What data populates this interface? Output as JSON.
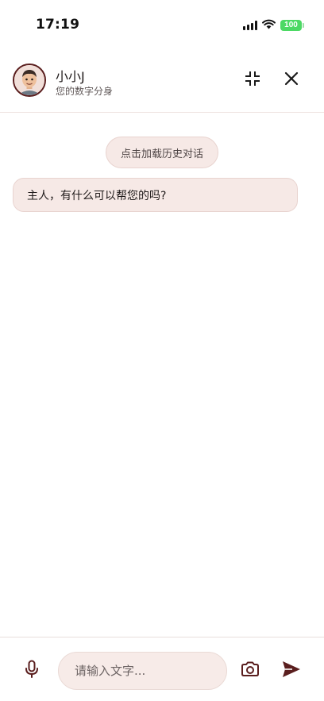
{
  "status_bar": {
    "time": "17:19",
    "battery_level": "100",
    "icons": [
      "signal-icon",
      "wifi-icon",
      "battery-icon"
    ],
    "battery_color": "#4cd964"
  },
  "header": {
    "bot_name": "小小J",
    "bot_subtitle": "您的数字分身",
    "icons": [
      "avatar",
      "collapse-icon",
      "close-icon"
    ]
  },
  "chat": {
    "load_history_label": "点击加载历史对话",
    "messages": [
      {
        "role": "bot",
        "text": "主人，有什么可以帮您的吗?"
      }
    ]
  },
  "input_bar": {
    "placeholder": "请输入文字...",
    "icons": [
      "microphone-icon",
      "camera-icon",
      "send-icon"
    ]
  },
  "colors": {
    "accent": "#5a1e1e",
    "bubble_bg": "#f6e9e6",
    "bubble_border": "#e8d3cf"
  }
}
